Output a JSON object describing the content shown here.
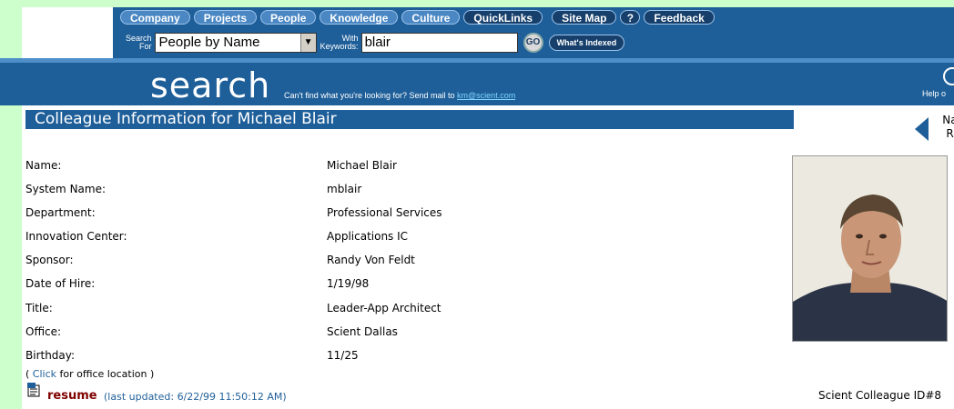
{
  "nav": {
    "items": [
      "Company",
      "Projects",
      "People",
      "Knowledge",
      "Culture",
      "QuickLinks",
      "Site Map",
      "?",
      "Feedback"
    ]
  },
  "search_form": {
    "search_label_line1": "Search",
    "search_label_line2": "For",
    "search_type": "People by Name",
    "with_label_line1": "With",
    "with_label_line2": "Keywords:",
    "keywords_value": "blair",
    "go_label": "GO",
    "whats_indexed_label": "What's Indexed"
  },
  "banner": {
    "search_word": "search",
    "message": "Can't find what you're looking for? Send mail to ",
    "email": "km@scient.com",
    "help_text": "Help o"
  },
  "page_title": "Colleague Information for Michael Blair",
  "nav_control": {
    "line1": "Nav",
    "line2": "Ro"
  },
  "details": [
    {
      "label": "Name:",
      "value": "Michael Blair"
    },
    {
      "label": "System Name:",
      "value": "mblair"
    },
    {
      "label": "Department:",
      "value": "Professional Services"
    },
    {
      "label": "Innovation Center:",
      "value": "Applications IC"
    },
    {
      "label": "Sponsor:",
      "value": "Randy Von Feldt"
    },
    {
      "label": "Date of Hire:",
      "value": "1/19/98"
    },
    {
      "label": "Title:",
      "value": "Leader-App Architect"
    },
    {
      "label": "Office:",
      "value": "Scient Dallas"
    },
    {
      "label": "Birthday:",
      "value": "11/25"
    }
  ],
  "office_note": {
    "prefix": "( ",
    "link": "Click",
    "suffix": " for office location )"
  },
  "resume": {
    "link": "resume",
    "updated": "(last updated: 6/22/99 11:50:12 AM)"
  },
  "colleague_id": "Scient Colleague ID#8",
  "colors": {
    "banner_blue": "#1f5f99",
    "page_green": "#ccffcc",
    "resume_red": "#800000"
  }
}
